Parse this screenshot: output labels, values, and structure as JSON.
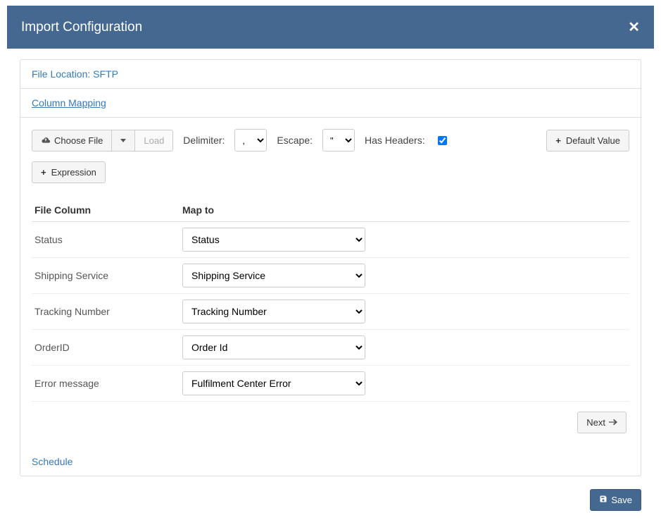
{
  "header": {
    "title": "Import Configuration"
  },
  "sections": {
    "file_location_label": "File Location: SFTP",
    "column_mapping_label": "Column Mapping",
    "schedule_label": "Schedule"
  },
  "toolbar": {
    "choose_file": "Choose File",
    "load": "Load",
    "delimiter_label": "Delimiter:",
    "delimiter_value": ",",
    "escape_label": "Escape:",
    "escape_value": "\"",
    "has_headers_label": "Has Headers:",
    "has_headers_checked": true,
    "default_value": "Default Value",
    "expression": "Expression"
  },
  "table": {
    "headers": {
      "file_column": "File Column",
      "map_to": "Map to"
    },
    "rows": [
      {
        "file_column": "Status",
        "map_to": "Status"
      },
      {
        "file_column": "Shipping Service",
        "map_to": "Shipping Service"
      },
      {
        "file_column": "Tracking Number",
        "map_to": "Tracking Number"
      },
      {
        "file_column": "OrderID",
        "map_to": "Order Id"
      },
      {
        "file_column": "Error message",
        "map_to": "Fulfilment Center Error"
      }
    ]
  },
  "footer": {
    "next": "Next",
    "save": "Save"
  }
}
